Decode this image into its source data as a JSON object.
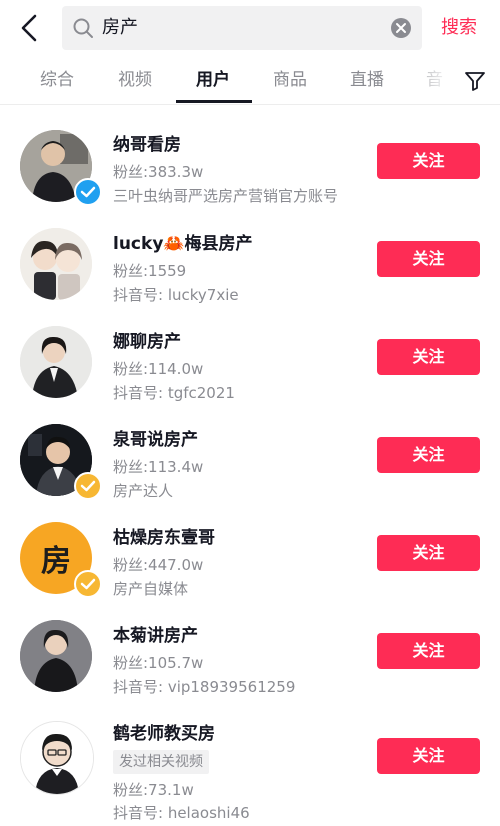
{
  "search": {
    "query": "房产",
    "button_label": "搜索"
  },
  "tabs": [
    "综合",
    "视频",
    "用户",
    "商品",
    "直播",
    "音"
  ],
  "active_tab": "用户",
  "colors": {
    "accent": "#fe2c55",
    "verified_blue": "#20a0f0",
    "verified_gold": "#f7b733"
  },
  "users": [
    {
      "name": "纳哥看房",
      "fans": "粉丝:383.3w",
      "line2": "三叶虫纳哥严选房产营销官方账号",
      "badge": "blue",
      "follow": "关注"
    },
    {
      "name": "lucky🦀梅县房产",
      "fans": "粉丝:1559",
      "line2": "抖音号: lucky7xie",
      "badge": "",
      "follow": "关注"
    },
    {
      "name": "娜聊房产",
      "fans": "粉丝:114.0w",
      "line2": "抖音号: tgfc2021",
      "badge": "",
      "follow": "关注"
    },
    {
      "name": "泉哥说房产",
      "fans": "粉丝:113.4w",
      "line2": "房产达人",
      "badge": "gold",
      "follow": "关注"
    },
    {
      "name": "枯燥房东壹哥",
      "fans": "粉丝:447.0w",
      "line2": "房产自媒体",
      "badge": "gold",
      "follow": "关注",
      "avatar_text": "房"
    },
    {
      "name": "本菊讲房产",
      "fans": "粉丝:105.7w",
      "line2": "抖音号: vip18939561259",
      "badge": "",
      "follow": "关注"
    },
    {
      "name": "鹤老师教买房",
      "tag": "发过相关视频",
      "fans": "粉丝:73.1w",
      "line2": "抖音号: helaoshi46",
      "badge": "",
      "follow": "关注"
    }
  ]
}
